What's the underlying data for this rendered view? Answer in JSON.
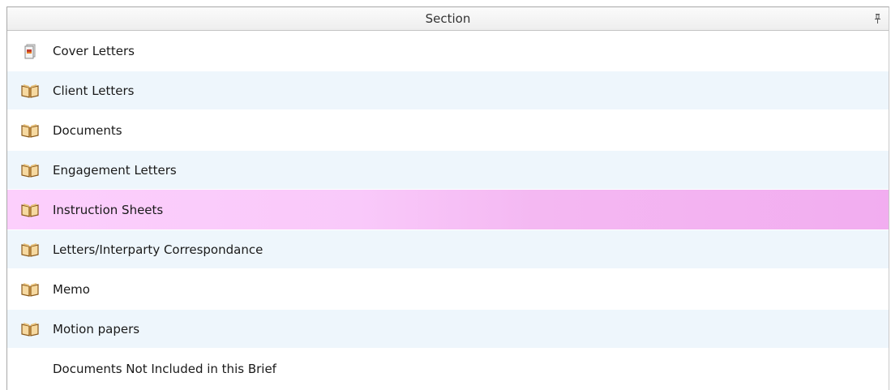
{
  "grid": {
    "header": "Section",
    "rows": [
      {
        "label": "Cover Letters",
        "icon": "cover-letter-icon"
      },
      {
        "label": "Client Letters",
        "icon": "book-icon"
      },
      {
        "label": "Documents",
        "icon": "book-icon"
      },
      {
        "label": "Engagement Letters",
        "icon": "book-icon"
      },
      {
        "label": "Instruction Sheets",
        "icon": "book-icon",
        "selected": true
      },
      {
        "label": "Letters/Interparty Correspondance",
        "icon": "book-icon"
      },
      {
        "label": "Memo",
        "icon": "book-icon"
      },
      {
        "label": "Motion papers",
        "icon": "book-icon"
      },
      {
        "label": "Documents Not Included in this Brief",
        "icon": "none"
      }
    ]
  },
  "colors": {
    "selected_row": "#f5b9f4",
    "alt_row": "#eef6fc",
    "book": "#c8923a"
  }
}
